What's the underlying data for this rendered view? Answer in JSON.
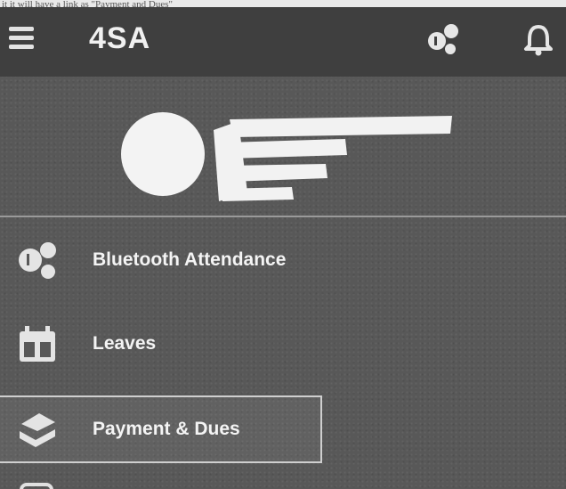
{
  "caption": "it it will have a link as \"Payment and Dues\"",
  "appbar": {
    "menu_icon": "hamburger-menu-icon",
    "logo": "4SA",
    "bluetooth_icon": "bluetooth-attendance-icon",
    "bell_icon": "notification-bell-icon"
  },
  "profile": {
    "avatar": "avatar-placeholder",
    "name_redacted": true
  },
  "menu": {
    "items": [
      {
        "label": "Bluetooth Attendance",
        "icon": "bluetooth-attendance-icon",
        "active": false
      },
      {
        "label": "Leaves",
        "icon": "calendar-icon",
        "active": false
      },
      {
        "label": "Payment & Dues",
        "icon": "payment-hand-icon",
        "active": true
      }
    ]
  },
  "colors": {
    "appbar": "#3f3f3f",
    "drawer": "#585858",
    "text": "#f4f4f4"
  }
}
